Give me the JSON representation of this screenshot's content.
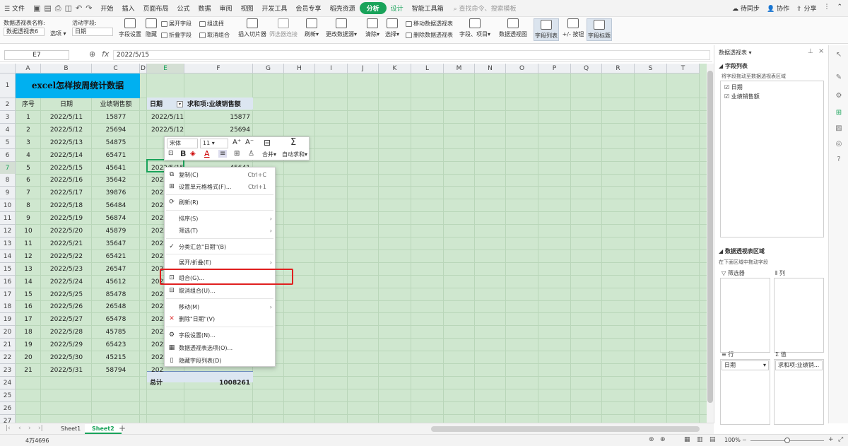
{
  "menu": {
    "file": "文件",
    "items": [
      "开始",
      "插入",
      "页面布局",
      "公式",
      "数据",
      "审阅",
      "视图",
      "开发工具",
      "会员专享",
      "稻壳资源"
    ],
    "active_tab": "分析",
    "design_tab": "设计",
    "smart_tab": "智能工具箱",
    "search": "查找命令、搜索模板",
    "sync": "待同步",
    "collab": "协作",
    "share": "分享"
  },
  "ribbon": {
    "pivot_name_label": "数据透视表名称:",
    "pivot_name": "数据透视表6",
    "options": "选项",
    "active_field_label": "活动字段:",
    "active_field": "日期",
    "field_settings": "字段设置",
    "hide": "隐藏",
    "expand_field": "展开字段",
    "collapse_field": "折叠字段",
    "group_selection": "组选择",
    "ungroup": "取消组合",
    "insert_slicer": "插入切片器",
    "filter_connections": "筛选器连接",
    "refresh": "刷新",
    "change_source": "更改数据源",
    "clear": "清除",
    "select": "选择",
    "move_pivot": "移动数据透视表",
    "delete_pivot": "删除数据透视表",
    "fields_items": "字段、项目",
    "pivot_chart": "数据透视图",
    "field_list": "字段列表",
    "plus_minus": "+/- 按钮",
    "field_headers": "字段标题"
  },
  "formula": {
    "namebox": "E7",
    "fx": "fx",
    "value": "2022/5/15"
  },
  "columns": [
    "A",
    "B",
    "C",
    "D",
    "E",
    "F",
    "G",
    "H",
    "I",
    "J",
    "K",
    "L",
    "M",
    "N",
    "O",
    "P",
    "Q",
    "R",
    "S",
    "T"
  ],
  "rows": [
    "1",
    "2",
    "3",
    "4",
    "5",
    "6",
    "7",
    "8",
    "9",
    "10",
    "11",
    "12",
    "13",
    "14",
    "15",
    "16",
    "17",
    "18",
    "19",
    "20",
    "21",
    "22",
    "23",
    "24",
    "25",
    "26",
    "27"
  ],
  "sheet": {
    "title": "excel怎样按周统计数据",
    "headers": [
      "序号",
      "日期",
      "业绩销售额"
    ],
    "data": [
      [
        "1",
        "2022/5/11",
        "15877"
      ],
      [
        "2",
        "2022/5/12",
        "25694"
      ],
      [
        "3",
        "2022/5/13",
        "54875"
      ],
      [
        "4",
        "2022/5/14",
        "65471"
      ],
      [
        "5",
        "2022/5/15",
        "45641"
      ],
      [
        "6",
        "2022/5/16",
        "35642"
      ],
      [
        "7",
        "2022/5/17",
        "39876"
      ],
      [
        "8",
        "2022/5/18",
        "56484"
      ],
      [
        "9",
        "2022/5/19",
        "56874"
      ],
      [
        "10",
        "2022/5/20",
        "45879"
      ],
      [
        "11",
        "2022/5/21",
        "35647"
      ],
      [
        "12",
        "2022/5/22",
        "65421"
      ],
      [
        "13",
        "2022/5/23",
        "26547"
      ],
      [
        "14",
        "2022/5/24",
        "45612"
      ],
      [
        "15",
        "2022/5/25",
        "85478"
      ],
      [
        "16",
        "2022/5/26",
        "26548"
      ],
      [
        "17",
        "2022/5/27",
        "65478"
      ],
      [
        "18",
        "2022/5/28",
        "45785"
      ],
      [
        "19",
        "2022/5/29",
        "65423"
      ],
      [
        "20",
        "2022/5/30",
        "45215"
      ],
      [
        "21",
        "2022/5/31",
        "58794"
      ]
    ]
  },
  "pivot": {
    "col1": "日期",
    "col2": "求和项:业绩销售额",
    "visible": [
      [
        "2022/5/11",
        "15877"
      ],
      [
        "2022/5/12",
        "25694"
      ],
      [
        "2022/5/15",
        "45641"
      ]
    ],
    "partial": "2022",
    "total_label": "总计",
    "total": "1008261"
  },
  "minitb": {
    "font": "宋体",
    "size": "11",
    "merge": "合并",
    "autosum": "自动求和"
  },
  "context_menu": [
    {
      "label": "复制(C)",
      "shortcut": "Ctrl+C",
      "icon": "copy"
    },
    {
      "label": "设置单元格格式(F)...",
      "shortcut": "Ctrl+1",
      "icon": "format"
    },
    {
      "label": "刷新(R)",
      "icon": "refresh"
    },
    {
      "label": "排序(S)",
      "arrow": true
    },
    {
      "label": "筛选(T)",
      "arrow": true
    },
    {
      "label": "分类汇总\"日期\"(B)",
      "icon": "check"
    },
    {
      "label": "展开/折叠(E)",
      "arrow": true
    },
    {
      "label": "组合(G)...",
      "icon": "group"
    },
    {
      "label": "取消组合(U)...",
      "icon": "ungroup"
    },
    {
      "label": "移动(M)",
      "arrow": true
    },
    {
      "label": "删除\"日期\"(V)",
      "icon": "delete"
    },
    {
      "label": "字段设置(N)...",
      "icon": "fieldset"
    },
    {
      "label": "数据透视表选项(O)...",
      "icon": "pivotopt"
    },
    {
      "label": "隐藏字段列表(D)",
      "icon": "hidelist"
    }
  ],
  "panel": {
    "title": "数据透视表",
    "field_list": "字段列表",
    "drag_hint": "将字段拖动至数据透视表区域",
    "fields": [
      "日期",
      "业绩销售额"
    ],
    "area_title": "数据透视表区域",
    "area_hint": "在下面区域中拖动字段",
    "filter": "筛选器",
    "column": "列",
    "row": "行",
    "value": "值",
    "row_field": "日期",
    "value_field": "求和项:业绩销..."
  },
  "sheets": [
    "Sheet1",
    "Sheet2"
  ],
  "status": {
    "left": "4万4696",
    "zoom": "100%"
  }
}
